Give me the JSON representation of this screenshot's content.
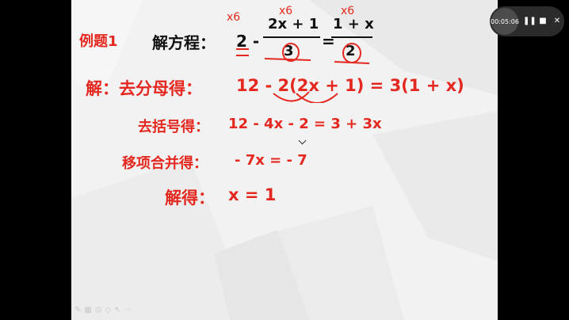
{
  "example_label": "例题1",
  "equation": {
    "prefix": "解方程：",
    "lead": "2 -",
    "num1": "2x + 1",
    "den1": "3",
    "equals": "=",
    "num2": "1 + x",
    "den2": "2"
  },
  "steps": [
    {
      "label": "解：去分母得：",
      "expr": "12 - 2(2x + 1) = 3(1 + x)"
    },
    {
      "label": "去括号得：",
      "expr": "12 - 4x - 2 = 3 + 3x"
    },
    {
      "label": "移项合并得：",
      "expr": "- 7x =  - 7"
    },
    {
      "label": "解得：",
      "expr": "x = 1"
    }
  ],
  "handwritten_marks": [
    "x6",
    "x6",
    "x6"
  ],
  "player": {
    "time": "00:05:06",
    "pause_icon": "pause-icon",
    "stop_icon": "stop-icon",
    "close_icon": "close-icon"
  },
  "toolbar_icons": [
    "pen-icon",
    "grid-icon",
    "laser-icon",
    "eraser-icon",
    "pointer-icon",
    "more-icon"
  ],
  "colors": {
    "accent_red": "#e4281f",
    "text_dark": "#111111",
    "slide_bg": "#f2f2f2"
  }
}
